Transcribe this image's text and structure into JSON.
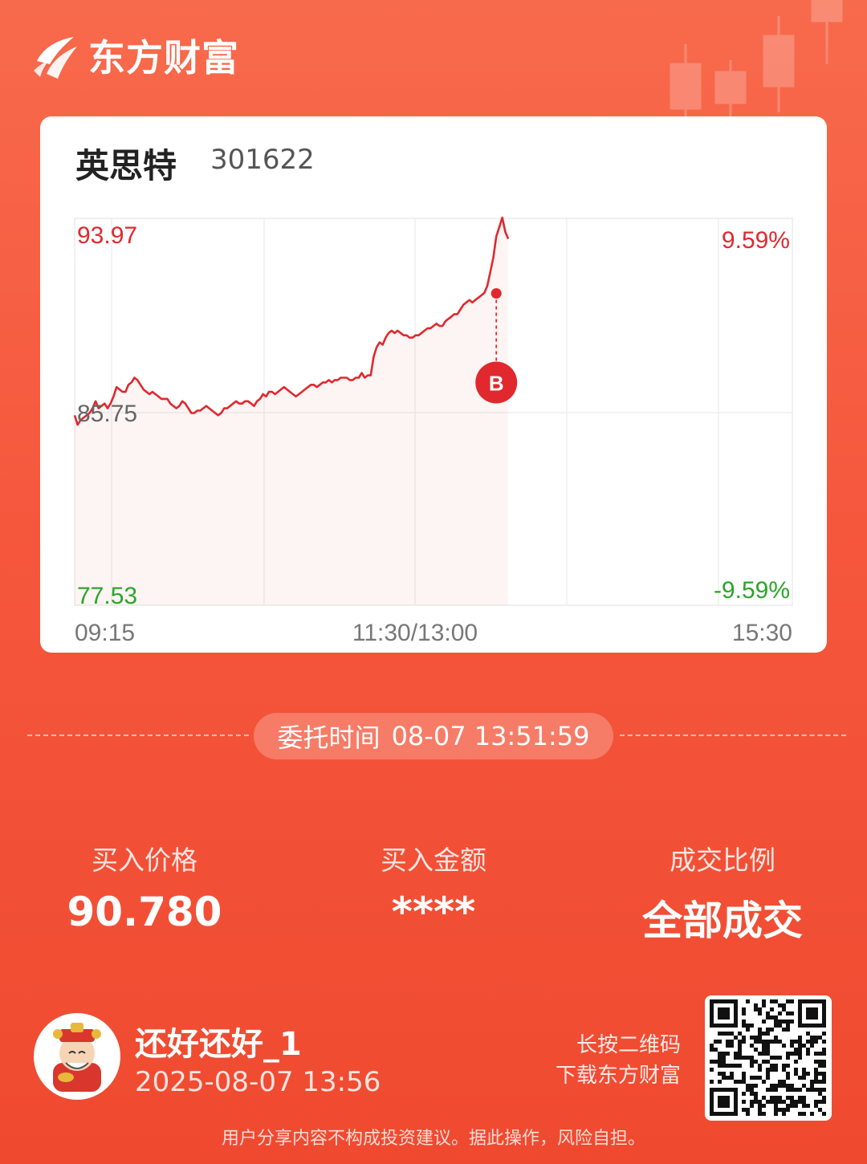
{
  "brand": {
    "name": "东方财富",
    "logo_icon": "eastmoney-logo-icon"
  },
  "stock": {
    "name": "英思特",
    "code": "301622"
  },
  "chart_data": {
    "type": "line",
    "y_labels": {
      "high": "93.97",
      "mid": "85.75",
      "low": "77.53"
    },
    "pct_labels": {
      "high": "9.59%",
      "low": "-9.59%"
    },
    "x_labels": [
      "09:15",
      "11:30/13:00",
      "15:30"
    ],
    "ylim": [
      77.53,
      93.97
    ],
    "session_minutes": 240,
    "buy_marker": {
      "label": "B",
      "minute": 141,
      "price": 90.78
    },
    "series": [
      {
        "values": [
          85.6,
          85.2,
          85.4,
          85.5,
          85.6,
          85.7,
          85.9,
          86.2,
          85.9,
          86.0,
          86.1,
          85.9,
          86.1,
          86.4,
          86.8,
          86.7,
          86.6,
          86.6,
          86.9,
          87.0,
          87.2,
          87.1,
          86.9,
          86.7,
          86.6,
          86.5,
          86.6,
          86.5,
          86.4,
          86.3,
          86.3,
          86.3,
          86.1,
          86.0,
          85.9,
          86.0,
          86.2,
          86.1,
          85.9,
          85.7,
          85.7,
          85.8,
          85.8,
          85.9,
          86.0,
          85.9,
          85.8,
          85.7,
          85.6,
          85.7,
          85.9,
          85.9,
          86.0,
          86.1,
          86.2,
          86.1,
          86.1,
          86.2,
          86.2,
          86.1,
          86.0,
          86.2,
          86.3,
          86.5,
          86.4,
          86.6,
          86.6,
          86.5,
          86.6,
          86.7,
          86.8,
          86.7,
          86.6,
          86.5,
          86.4,
          86.5,
          86.6,
          86.7,
          86.8,
          86.9,
          86.9,
          86.8,
          86.9,
          87.0,
          87.0,
          87.1,
          87.0,
          87.1,
          87.1,
          87.2,
          87.2,
          87.2,
          87.1,
          87.1,
          87.2,
          87.2,
          87.4,
          87.2,
          87.3,
          87.3,
          88.1,
          88.5,
          88.7,
          88.6,
          88.9,
          89.1,
          89.2,
          89.1,
          89.2,
          89.1,
          89.0,
          89.0,
          88.9,
          88.9,
          89.0,
          89.0,
          89.1,
          89.2,
          89.3,
          89.3,
          89.4,
          89.5,
          89.4,
          89.4,
          89.6,
          89.7,
          89.8,
          89.9,
          89.9,
          90.1,
          90.3,
          90.4,
          90.5,
          90.4,
          90.5,
          90.6,
          90.7,
          90.8,
          91.1,
          91.7,
          92.3,
          93.2,
          93.6,
          94.0,
          93.4,
          93.1
        ]
      }
    ]
  },
  "order": {
    "label": "委托时间",
    "time": "08-07 13:51:59"
  },
  "stats": [
    {
      "label": "买入价格",
      "value": "90.780"
    },
    {
      "label": "买入金额",
      "value": "****"
    },
    {
      "label": "成交比例",
      "value": "全部成交"
    }
  ],
  "user": {
    "name": "还好还好_1",
    "time": "2025-08-07 13:56",
    "avatar_icon": "caishen-avatar-icon"
  },
  "qr": {
    "hint_line1": "长按二维码",
    "hint_line2": "下载东方财富",
    "icon": "qr-code-icon"
  },
  "disclaimer": "用户分享内容不构成投资建议。据此操作，风险自担。",
  "colors": {
    "up": "#e0282e",
    "down": "#2aa52a",
    "neutral": "#666666",
    "background": "#f5573d"
  }
}
